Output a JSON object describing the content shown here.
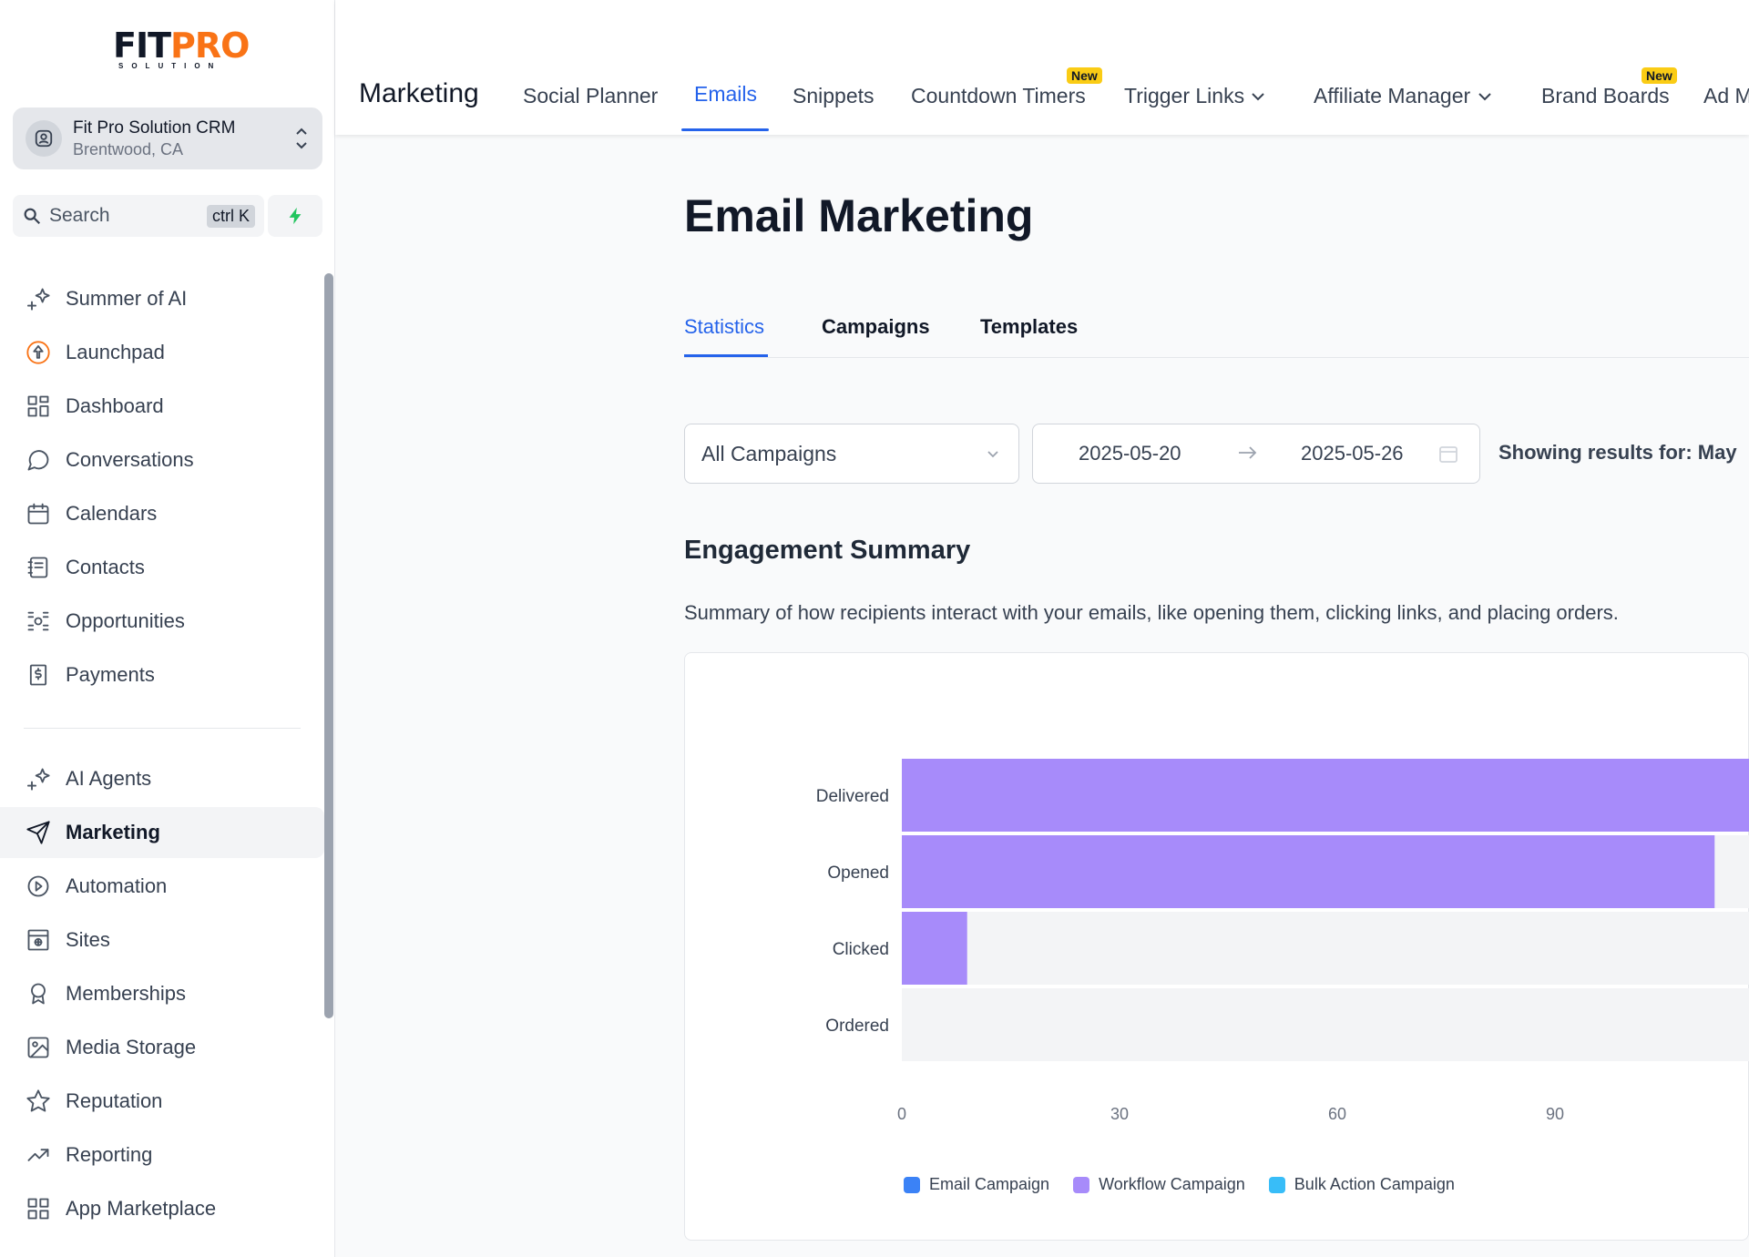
{
  "brand": {
    "logo_fit": "FIT",
    "logo_pro": "PRO",
    "logo_sub": "SOLUTION"
  },
  "account": {
    "name": "Fit Pro Solution CRM",
    "location": "Brentwood, CA"
  },
  "search": {
    "label": "Search",
    "shortcut": "ctrl K"
  },
  "sidebar": {
    "items": [
      {
        "label": "Summer of AI",
        "icon": "sparkles-icon"
      },
      {
        "label": "Launchpad",
        "icon": "rocket-icon"
      },
      {
        "label": "Dashboard",
        "icon": "grid-icon"
      },
      {
        "label": "Conversations",
        "icon": "chat-icon"
      },
      {
        "label": "Calendars",
        "icon": "calendar-icon"
      },
      {
        "label": "Contacts",
        "icon": "contacts-icon"
      },
      {
        "label": "Opportunities",
        "icon": "opportunities-icon"
      },
      {
        "label": "Payments",
        "icon": "payments-icon"
      },
      {
        "label": "AI Agents",
        "icon": "sparkles-icon"
      },
      {
        "label": "Marketing",
        "icon": "send-icon"
      },
      {
        "label": "Automation",
        "icon": "automation-icon"
      },
      {
        "label": "Sites",
        "icon": "sites-icon"
      },
      {
        "label": "Memberships",
        "icon": "award-icon"
      },
      {
        "label": "Media Storage",
        "icon": "image-icon"
      },
      {
        "label": "Reputation",
        "icon": "star-icon"
      },
      {
        "label": "Reporting",
        "icon": "trend-icon"
      },
      {
        "label": "App Marketplace",
        "icon": "apps-icon"
      }
    ]
  },
  "topnav": {
    "title": "Marketing",
    "tabs": [
      {
        "label": "Social Planner"
      },
      {
        "label": "Emails"
      },
      {
        "label": "Snippets"
      },
      {
        "label": "Countdown Timers",
        "badge": "New"
      },
      {
        "label": "Trigger Links"
      },
      {
        "label": "Affiliate Manager"
      },
      {
        "label": "Brand Boards",
        "badge": "New"
      },
      {
        "label": "Ad M"
      }
    ]
  },
  "page": {
    "title": "Email Marketing",
    "subtabs": [
      "Statistics",
      "Campaigns",
      "Templates"
    ],
    "filter": {
      "campaign": "All Campaigns",
      "date_from": "2025-05-20",
      "date_to": "2025-05-26",
      "showing": "Showing results for: May"
    },
    "section_title": "Engagement Summary",
    "section_desc": "Summary of how recipients interact with your emails, like opening them, clicking links, and placing orders."
  },
  "colors": {
    "accent": "#2563eb",
    "bar": "#a78bfa",
    "email": "#3b82f6",
    "workflow": "#a78bfa",
    "bulk": "#38bdf8"
  },
  "chart_data": {
    "type": "bar",
    "orientation": "horizontal",
    "categories": [
      "Delivered",
      "Opened",
      "Clicked",
      "Ordered"
    ],
    "series": [
      {
        "name": "Email Campaign",
        "values": [
          0,
          0,
          0,
          0
        ]
      },
      {
        "name": "Workflow Campaign",
        "values": [
          125,
          112,
          9,
          0
        ]
      },
      {
        "name": "Bulk Action Campaign",
        "values": [
          0,
          0,
          0,
          0
        ]
      }
    ],
    "x_ticks": [
      0,
      30,
      60,
      90
    ],
    "xlim": [
      0,
      125
    ],
    "legend_position": "bottom"
  }
}
